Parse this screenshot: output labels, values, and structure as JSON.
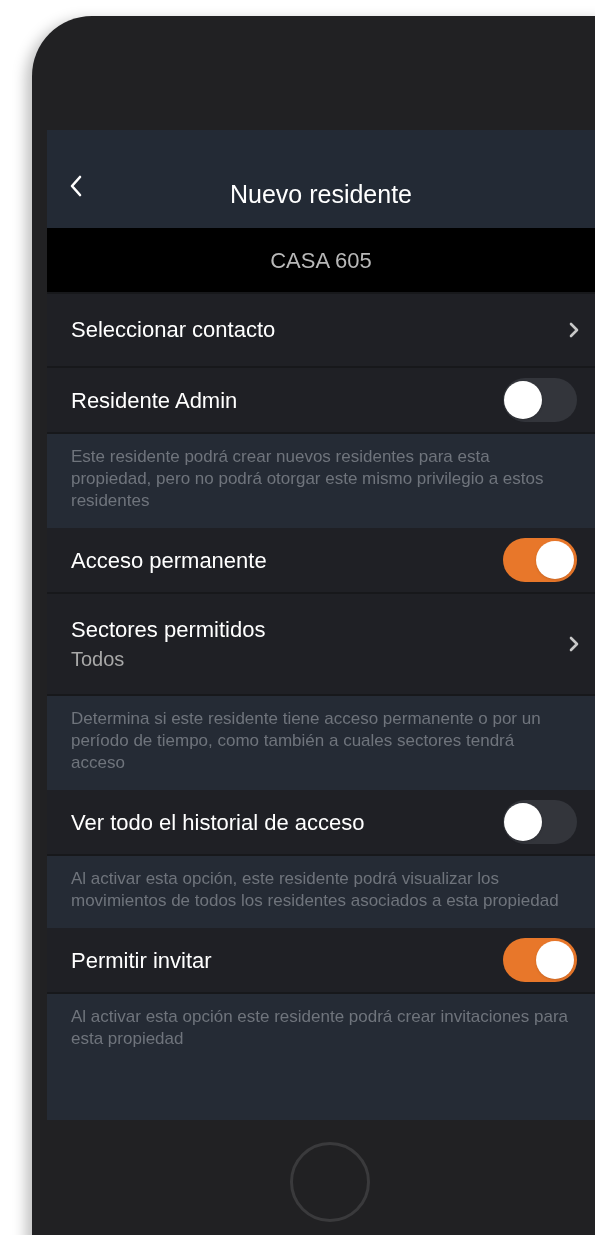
{
  "header": {
    "title": "Nuevo residente"
  },
  "banner": {
    "text": "CASA 605"
  },
  "items": [
    {
      "kind": "link",
      "label": "Seleccionar contacto"
    },
    {
      "kind": "toggle",
      "label": "Residente Admin",
      "on": false
    },
    {
      "kind": "note",
      "text": "Este residente podrá crear nuevos residentes para esta propiedad, pero no podrá otorgar este mismo privilegio a estos residentes"
    },
    {
      "kind": "toggle",
      "label": "Acceso permanente",
      "on": true
    },
    {
      "kind": "link",
      "label": "Sectores permitidos",
      "subtitle": "Todos"
    },
    {
      "kind": "note",
      "text": "Determina si este residente tiene acceso permanente o por un período de tiempo, como también a cuales sectores tendrá acceso"
    },
    {
      "kind": "toggle",
      "label": "Ver todo el historial de acceso",
      "on": false
    },
    {
      "kind": "note",
      "text": "Al activar esta opción, este residente podrá visualizar los movimientos de todos los residentes asociados a esta propiedad"
    },
    {
      "kind": "toggle",
      "label": "Permitir invitar",
      "on": true
    },
    {
      "kind": "note",
      "text": "Al activar esta opción este residente podrá crear invitaciones para esta propiedad"
    }
  ]
}
